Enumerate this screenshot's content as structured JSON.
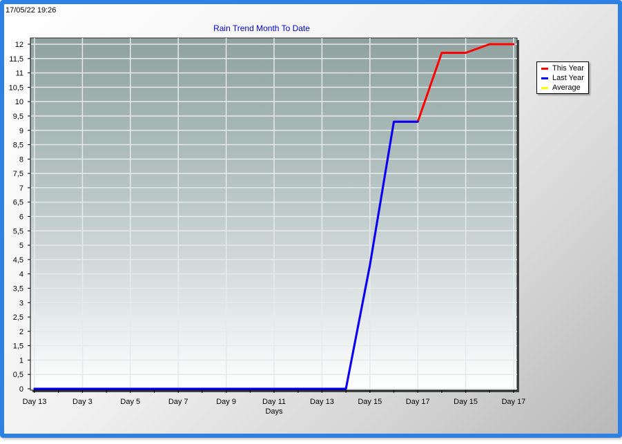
{
  "timestamp": "17/05/22 19:26",
  "chart_data": {
    "type": "line",
    "title": "Rain Trend Month To Date",
    "xlabel": "Days",
    "ylabel": "",
    "ylim": [
      0,
      12.25
    ],
    "yticks": [
      "0",
      "0,5",
      "1",
      "1,5",
      "2",
      "2,5",
      "3",
      "3,5",
      "4",
      "4,5",
      "5",
      "5,5",
      "6",
      "6,5",
      "7",
      "7,5",
      "8",
      "8,5",
      "9",
      "9,5",
      "10",
      "10,5",
      "11",
      "11,5",
      "12"
    ],
    "categories": [
      "Day 13",
      "",
      "Day 3",
      "",
      "Day 5",
      "",
      "Day 7",
      "",
      "Day 9",
      "",
      "Day 11",
      "",
      "Day 13",
      "",
      "Day 15",
      "",
      "Day 17",
      "",
      "Day 15",
      "",
      "Day 17"
    ],
    "grid": true,
    "legend_position": "right",
    "series": [
      {
        "name": "This Year",
        "color": "#ff0000",
        "values": [
          0,
          0,
          0,
          0,
          0,
          0,
          0,
          0,
          0,
          0,
          0,
          0,
          0,
          0,
          4.3,
          9.3,
          9.3,
          11.7,
          11.7,
          12,
          12
        ]
      },
      {
        "name": "Last Year",
        "color": "#0000ff",
        "values": [
          0,
          0,
          0,
          0,
          0,
          0,
          0,
          0,
          0,
          0,
          0,
          0,
          0,
          0,
          4.3,
          9.3,
          9.3
        ]
      },
      {
        "name": "Average",
        "color": "#ffff00",
        "values": []
      }
    ]
  }
}
